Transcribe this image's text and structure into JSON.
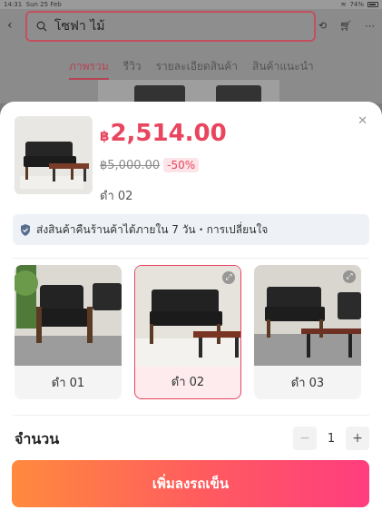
{
  "status_bar": {
    "time": "14:31",
    "date": "Sun 25 Feb",
    "battery": "74%"
  },
  "background": {
    "search_text": "โซฟา ไม้",
    "tabs": [
      {
        "label": "ภาพรวม",
        "active": true
      },
      {
        "label": "รีวิว",
        "active": false
      },
      {
        "label": "รายละเอียดสินค้า",
        "active": false
      },
      {
        "label": "สินค้าแนะนำ",
        "active": false
      }
    ]
  },
  "product": {
    "currency_symbol": "฿",
    "price": "2,514.00",
    "original_price": "฿5,000.00",
    "discount": "-50%",
    "selected_variant": "ดำ 02"
  },
  "policy": {
    "text": "ส่งสินค้าคืนร้านค้าได้ภายใน 7 วัน・การเปลี่ยนใจ",
    "icon": "shield-check-icon"
  },
  "variants": [
    {
      "label": "ดำ 01",
      "selected": false
    },
    {
      "label": "ดำ 02",
      "selected": true
    },
    {
      "label": "ดำ 03",
      "selected": false
    }
  ],
  "quantity": {
    "label": "จำนวน",
    "value": "1",
    "minus": "−",
    "plus": "+"
  },
  "cta": {
    "label": "เพิ่มลงรถเข็น"
  },
  "colors": {
    "accent": "#e8455e",
    "gradient_start": "#ff8a3d",
    "gradient_end": "#ff3d7f"
  }
}
